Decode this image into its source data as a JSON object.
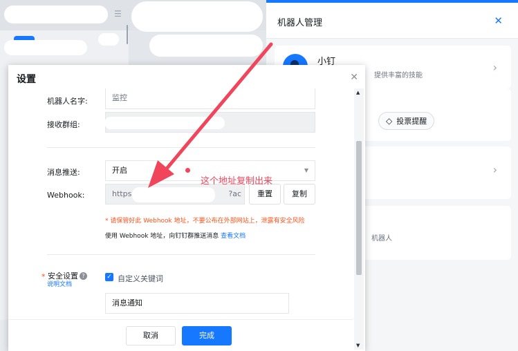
{
  "side_panel": {
    "title": "机器人管理",
    "close_icon": "close-icon",
    "bot": {
      "name": "小钉",
      "desc": "提供丰富的技能"
    },
    "vote_chip": "投票提醒",
    "robot_text": "机器人"
  },
  "dialog": {
    "title": "设置",
    "close_icon": "close-icon",
    "fields": {
      "robot_name_label": "机器人名字:",
      "robot_name_value": "监控",
      "group_label": "接收群组:",
      "push_label": "消息推送:",
      "push_value": "开启",
      "webhook_label": "Webhook:",
      "webhook_prefix": "https:",
      "webhook_suffix": "?ac",
      "reset_button": "重置",
      "copy_button": "复制",
      "warning": "* 请保管好此 Webhook 地址，不要公布在外部网站上，泄露有安全风险",
      "usage_text": "使用 Webhook 地址，向钉钉群推送消息",
      "usage_link": "查看文档",
      "security_label": "安全设置",
      "security_doc": "说明文档",
      "keyword_checkbox_label": "自定义关键词",
      "keyword_value": "消息通知"
    },
    "footer": {
      "cancel": "取消",
      "confirm": "完成"
    }
  },
  "annotation": {
    "text": "这个地址复制出来",
    "color": "#f0455a"
  },
  "colors": {
    "accent": "#1677ff",
    "warning": "#ff5219"
  }
}
